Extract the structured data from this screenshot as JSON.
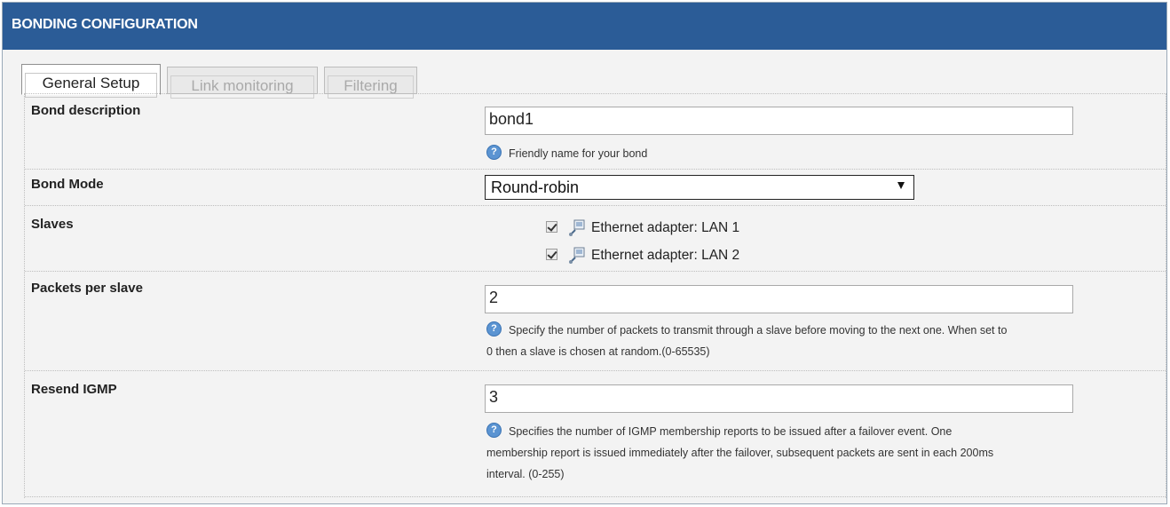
{
  "header": {
    "title": "BONDING CONFIGURATION"
  },
  "tabs": [
    {
      "label": "General Setup",
      "active": true
    },
    {
      "label": "Link monitoring",
      "active": false
    },
    {
      "label": "Filtering",
      "active": false
    }
  ],
  "fields": {
    "bond_description": {
      "label": "Bond description",
      "value": "bond1",
      "help": "Friendly name for your bond"
    },
    "bond_mode": {
      "label": "Bond Mode",
      "selected": "Round-robin"
    },
    "slaves": {
      "label": "Slaves",
      "items": [
        {
          "label": "Ethernet adapter: LAN 1",
          "checked": true
        },
        {
          "label": "Ethernet adapter: LAN 2",
          "checked": true
        }
      ]
    },
    "packets_per_slave": {
      "label": "Packets per slave",
      "value": "2",
      "help_line1": "Specify the number of packets to transmit through a slave before moving to the next one. When set to",
      "help_line2": "0 then a slave is chosen at random.(0-65535)"
    },
    "resend_igmp": {
      "label": "Resend IGMP",
      "value": "3",
      "help_line1": "Specifies the number of IGMP membership reports to be issued after a failover event. One",
      "help_line2": "membership report is issued immediately after the failover, subsequent packets are sent in each 200ms",
      "help_line3": "interval. (0-255)"
    }
  },
  "icons": {
    "help": "help-icon",
    "network": "network-adapter-icon",
    "dropdown": "chevron-down-icon"
  },
  "colors": {
    "header_bg": "#2b5c97",
    "panel_bg": "#f3f3f3",
    "help_icon": "#5b94d2"
  }
}
